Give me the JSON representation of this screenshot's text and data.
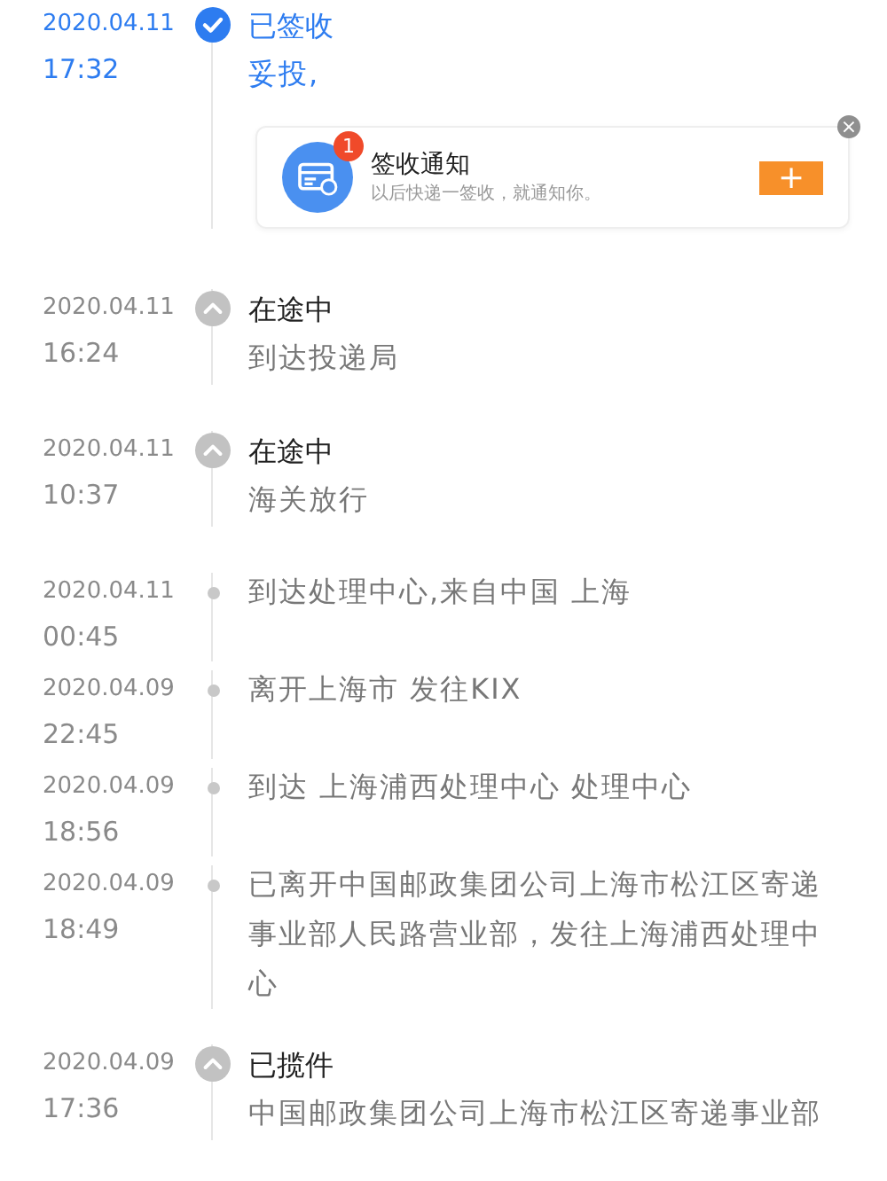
{
  "events": [
    {
      "kind": "signed",
      "date": "2020.04.11",
      "time": "17:32",
      "status": "已签收",
      "description": "妥投,",
      "card": {
        "title": "签收通知",
        "subtitle": "以后快递一签收，就通知你。",
        "badge": "1",
        "button": "+",
        "close": "×"
      }
    },
    {
      "kind": "major",
      "date": "2020.04.11",
      "time": "16:24",
      "status": "在途中",
      "description": "到达投递局"
    },
    {
      "kind": "major",
      "date": "2020.04.11",
      "time": "10:37",
      "status": "在途中",
      "description": "海关放行"
    },
    {
      "kind": "minor",
      "date": "2020.04.11",
      "time": "00:45",
      "description": "到达处理中心,来自中国 上海"
    },
    {
      "kind": "minor",
      "date": "2020.04.09",
      "time": "22:45",
      "description": "离开上海市 发往KIX"
    },
    {
      "kind": "minor",
      "date": "2020.04.09",
      "time": "18:56",
      "description": "到达 上海浦西处理中心 处理中心"
    },
    {
      "kind": "minor",
      "date": "2020.04.09",
      "time": "18:49",
      "description": "已离开中国邮政集团公司上海市松江区寄递事业部人民路营业部，发往上海浦西处理中心"
    },
    {
      "kind": "major",
      "date": "2020.04.09",
      "time": "17:36",
      "status": "已揽件",
      "description": "中国邮政集团公司上海市松江区寄递事业部"
    }
  ]
}
